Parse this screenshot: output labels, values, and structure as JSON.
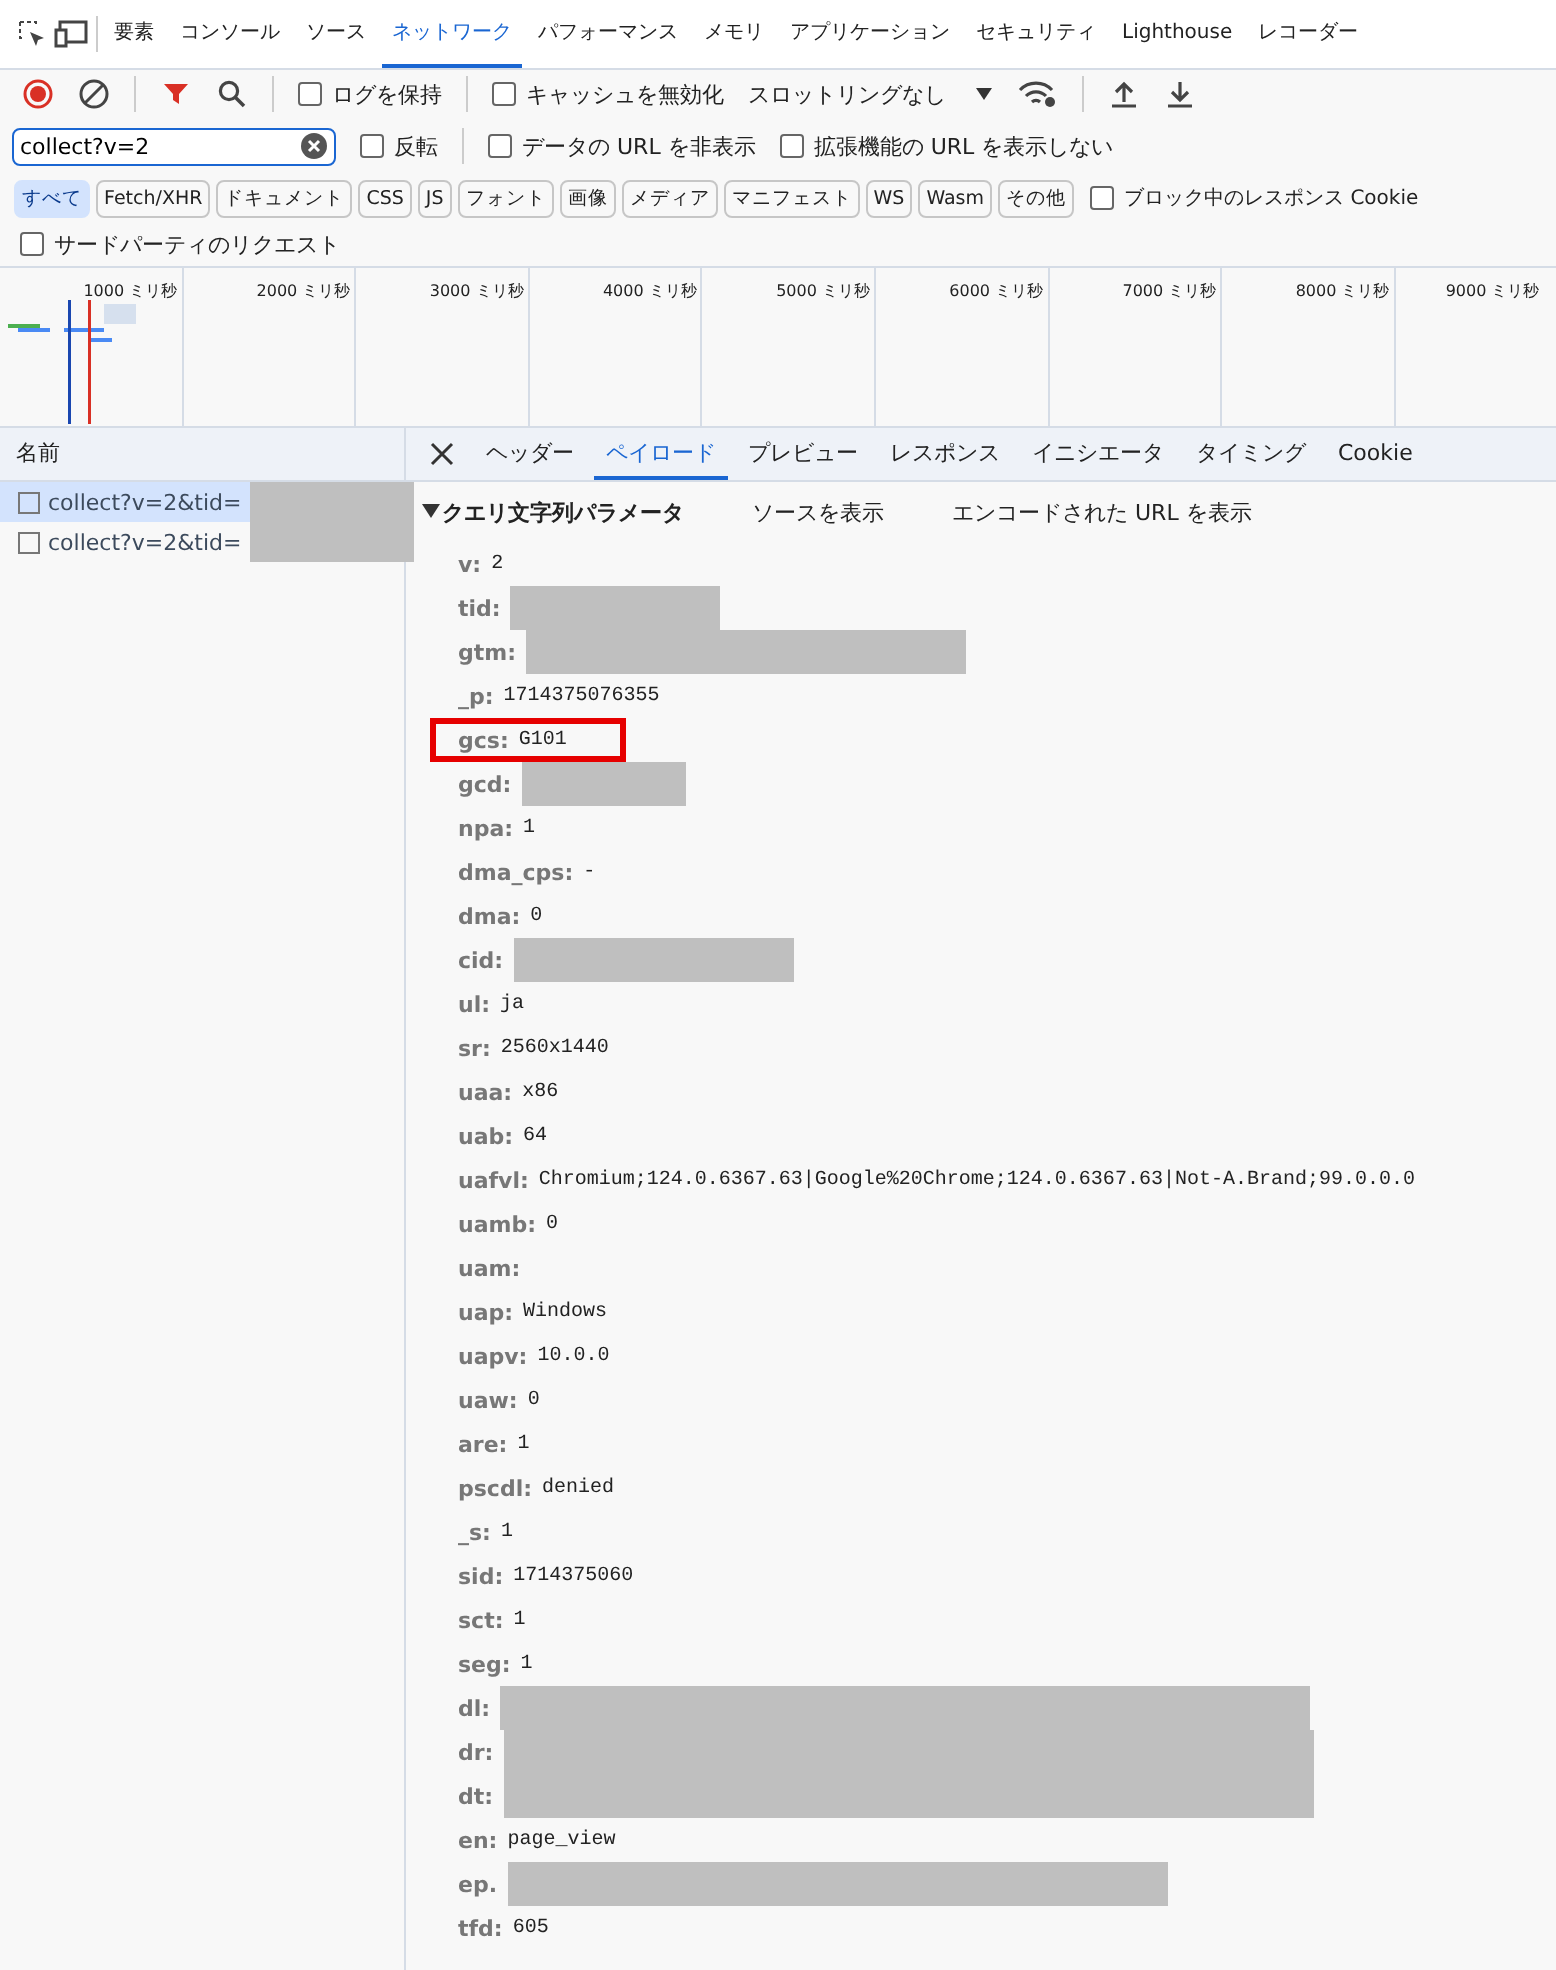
{
  "main_tabs": [
    {
      "label": "要素",
      "selected": false
    },
    {
      "label": "コンソール",
      "selected": false
    },
    {
      "label": "ソース",
      "selected": false
    },
    {
      "label": "ネットワーク",
      "selected": true
    },
    {
      "label": "パフォーマンス",
      "selected": false
    },
    {
      "label": "メモリ",
      "selected": false
    },
    {
      "label": "アプリケーション",
      "selected": false
    },
    {
      "label": "セキュリティ",
      "selected": false
    },
    {
      "label": "Lighthouse",
      "selected": false
    },
    {
      "label": "レコーダー",
      "selected": false
    }
  ],
  "toolbar": {
    "preserve_log": {
      "label": "ログを保持",
      "checked": false
    },
    "disable_cache": {
      "label": "キャッシュを無効化",
      "checked": false
    },
    "throttling": "スロットリングなし"
  },
  "filter": {
    "value": "collect?v=2",
    "options": [
      {
        "label": "反転",
        "checked": false
      },
      {
        "label": "データの URL を非表示",
        "checked": false
      },
      {
        "label": "拡張機能の URL を表示しない",
        "checked": false
      }
    ]
  },
  "type_filters": [
    {
      "label": "すべて",
      "selected": true
    },
    {
      "label": "Fetch/XHR",
      "selected": false
    },
    {
      "label": "ドキュメント",
      "selected": false
    },
    {
      "label": "CSS",
      "selected": false
    },
    {
      "label": "JS",
      "selected": false
    },
    {
      "label": "フォント",
      "selected": false
    },
    {
      "label": "画像",
      "selected": false
    },
    {
      "label": "メディア",
      "selected": false
    },
    {
      "label": "マニフェスト",
      "selected": false
    },
    {
      "label": "WS",
      "selected": false
    },
    {
      "label": "Wasm",
      "selected": false
    },
    {
      "label": "その他",
      "selected": false
    }
  ],
  "blocked_cookies": {
    "label": "ブロック中のレスポンス Cookie",
    "checked": false
  },
  "third_party": {
    "label": "サードパーティのリクエスト",
    "checked": false
  },
  "timeline_ticks": [
    "1000 ミリ秒",
    "2000 ミリ秒",
    "3000 ミリ秒",
    "4000 ミリ秒",
    "5000 ミリ秒",
    "6000 ミリ秒",
    "7000 ミリ秒",
    "8000 ミリ秒",
    "9000 ミリ秒"
  ],
  "requests": {
    "header": "名前",
    "rows": [
      {
        "name": "collect?v=2&tid=",
        "selected": true
      },
      {
        "name": "collect?v=2&tid=",
        "selected": false
      }
    ]
  },
  "detail_tabs": [
    {
      "label": "ヘッダー",
      "selected": false
    },
    {
      "label": "ペイロード",
      "selected": true
    },
    {
      "label": "プレビュー",
      "selected": false
    },
    {
      "label": "レスポンス",
      "selected": false
    },
    {
      "label": "イニシエータ",
      "selected": false
    },
    {
      "label": "タイミング",
      "selected": false
    },
    {
      "label": "Cookie",
      "selected": false
    }
  ],
  "payload": {
    "section_title": "クエリ文字列パラメータ",
    "expanded": true,
    "view_source": "ソースを表示",
    "view_encoded": "エンコードされた URL を表示",
    "params": [
      {
        "key": "v:",
        "value": "2"
      },
      {
        "key": "tid:",
        "redacted": true
      },
      {
        "key": "gtm:",
        "redacted": true
      },
      {
        "key": "_p:",
        "value": "1714375076355"
      },
      {
        "key": "gcs:",
        "value": "G101",
        "highlighted": true
      },
      {
        "key": "gcd:",
        "redacted": true
      },
      {
        "key": "npa:",
        "value": "1"
      },
      {
        "key": "dma_cps:",
        "value": "-"
      },
      {
        "key": "dma:",
        "value": "0"
      },
      {
        "key": "cid:",
        "redacted": true
      },
      {
        "key": "ul:",
        "value": "ja"
      },
      {
        "key": "sr:",
        "value": "2560x1440"
      },
      {
        "key": "uaa:",
        "value": "x86"
      },
      {
        "key": "uab:",
        "value": "64"
      },
      {
        "key": "uafvl:",
        "value": "Chromium;124.0.6367.63|Google%20Chrome;124.0.6367.63|Not-A.Brand;99.0.0.0"
      },
      {
        "key": "uamb:",
        "value": "0"
      },
      {
        "key": "uam:"
      },
      {
        "key": "uap:",
        "value": "Windows"
      },
      {
        "key": "uapv:",
        "value": "10.0.0"
      },
      {
        "key": "uaw:",
        "value": "0"
      },
      {
        "key": "are:",
        "value": "1"
      },
      {
        "key": "pscdl:",
        "value": "denied"
      },
      {
        "key": "_s:",
        "value": "1"
      },
      {
        "key": "sid:",
        "value": "1714375060"
      },
      {
        "key": "sct:",
        "value": "1"
      },
      {
        "key": "seg:",
        "value": "1"
      },
      {
        "key": "dl:",
        "redacted": true
      },
      {
        "key": "dr:",
        "redacted": true
      },
      {
        "key": "dt:",
        "redacted": true
      },
      {
        "key": "en:",
        "value": "page_view"
      },
      {
        "key": "ep.",
        "redacted": true
      },
      {
        "key": "tfd:",
        "value": "605"
      }
    ]
  }
}
